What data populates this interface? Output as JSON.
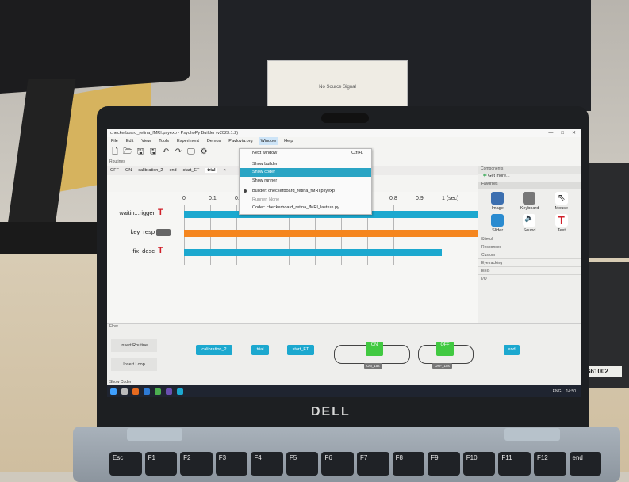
{
  "background_monitor": {
    "message": "No Source Signal"
  },
  "side_label": "IS61002",
  "laptop": {
    "brand": "DELL"
  },
  "keyboard_keys": [
    "Esc",
    "F1",
    "F2",
    "F3",
    "F4",
    "F5",
    "F6",
    "F7",
    "F8",
    "F9",
    "F10",
    "F11",
    "F12",
    "end"
  ],
  "window": {
    "title": "checkerboard_retina_fMRI.psyexp - PsychoPy Builder (v2023.1.2)",
    "controls": [
      "—",
      "□",
      "✕"
    ]
  },
  "menubar": [
    "File",
    "Edit",
    "View",
    "Tools",
    "Experiment",
    "Demos",
    "Pavlovia.org",
    "Window",
    "Help"
  ],
  "active_menu": "Window",
  "window_menu": {
    "items": [
      {
        "label": "Next window",
        "shortcut": "Ctrl+L"
      },
      {
        "label": "Show builder"
      },
      {
        "label": "Show coder",
        "highlighted": true
      },
      {
        "label": "Show runner"
      },
      {
        "label": "Builder: checkerboard_retina_fMRI.psyexp",
        "checked": true
      },
      {
        "label": "Runner: None"
      },
      {
        "label": "Coder: checkerboard_retina_fMRI_lastrun.py"
      }
    ]
  },
  "panes": {
    "routines": "Routines",
    "components": "Components",
    "flow": "Flow"
  },
  "routine_tabs": [
    "OFF",
    "ON",
    "calibration_2",
    "end",
    "start_ET",
    "trial"
  ],
  "active_routine": "trial",
  "timeline": {
    "ticks": [
      "0",
      "0.1",
      "0.2",
      "0.8",
      "0.9",
      "1 (sec)"
    ],
    "components": [
      {
        "name": "waitin...rigger",
        "icon": "text-icon"
      },
      {
        "name": "key_resp",
        "icon": "keyboard-icon"
      },
      {
        "name": "fix_desc",
        "icon": "text-icon"
      }
    ],
    "colors": {
      "teal": "#1ca8cf",
      "orange": "#f5861f"
    }
  },
  "components_panel": {
    "get_more": "Get more...",
    "favorites_label": "Favorites",
    "favorites": [
      {
        "label": "Image",
        "icon": "image-icon"
      },
      {
        "label": "Keyboard",
        "icon": "keyboard-icon"
      },
      {
        "label": "Mouse",
        "icon": "mouse-icon"
      },
      {
        "label": "Slider",
        "icon": "slider-icon"
      },
      {
        "label": "Sound",
        "icon": "sound-icon"
      },
      {
        "label": "Text",
        "icon": "text-icon"
      }
    ],
    "categories": [
      "Stimuli",
      "Responses",
      "Custom",
      "Eyetracking",
      "EEG",
      "I/O"
    ]
  },
  "flow": {
    "insert_routine": "Insert Routine",
    "insert_loop": "Insert Loop",
    "nodes": [
      "calibration_2",
      "trial",
      "start_ET",
      "ON",
      "OFF",
      "end"
    ],
    "loops": [
      "ON_15s",
      "OFF_15s"
    ]
  },
  "status_text": "Show Coder",
  "taskbar": {
    "language": "ENG",
    "time": "14:50"
  }
}
